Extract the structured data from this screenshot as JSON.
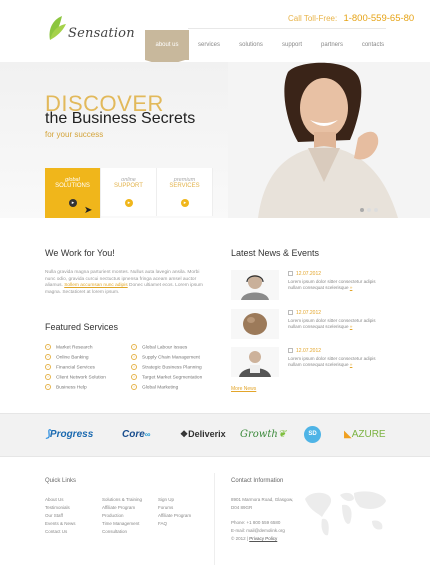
{
  "brand": {
    "name": "Sensation"
  },
  "header": {
    "phone_label": "Call Toll-Free:",
    "phone_number": "1-800-559-65-80"
  },
  "nav": [
    "about us",
    "services",
    "solutions",
    "support",
    "partners",
    "contacts"
  ],
  "hero": {
    "title1": "DISCOVER",
    "title2": "the Business Secrets",
    "title3": "for your success",
    "tabs": [
      {
        "script": "global",
        "label": "SOLUTIONS"
      },
      {
        "script": "online",
        "label": "SUPPORT"
      },
      {
        "script": "premium",
        "label": "SERVICES"
      }
    ]
  },
  "work": {
    "title": "We Work for You!",
    "para1": "Nulla gravida magna parturient montes. Nullus auta lavegin ansila. Morbi nunc odio, gravida curcui nectuctus ipnensa fringa aceam amsel auctor aliamus.",
    "link": "Sollem accumsan nunc adipis",
    "para2": "Donec ultiamet ecos. Lorem ipsum magna. Sectatioret at lorem ipsum."
  },
  "featured": {
    "title": "Featured Services",
    "col1": [
      "Market Research",
      "Online Banking",
      "Financial Services",
      "Client Network Solution",
      "Business Help"
    ],
    "col2": [
      "Global Labour Issues",
      "Supply Chain Management",
      "Strategic Business Planning",
      "Target Market Segmentation",
      "Global Marketing"
    ]
  },
  "news": {
    "title": "Latest News & Events",
    "items": [
      {
        "date": "12.07.2012",
        "text": "Lorem ipsum dolor sitter consectetur adipis nullam consequat scelerisque",
        "more": "»"
      },
      {
        "date": "12.07.2012",
        "text": "Lorem ipsum dolor sitter consectetur adipis nullam consequat scelerisque",
        "more": "»"
      },
      {
        "date": "12.07.2012",
        "text": "Lorem ipsum dolor sitter consectetur adipis nullam consequat scelerisque",
        "more": "»"
      }
    ],
    "more_label": "More News"
  },
  "partners": [
    "Progress",
    "Core",
    "Deliverix",
    "Growth",
    "SD",
    "AZURE"
  ],
  "footer": {
    "quick_title": "Quick Links",
    "links_col1": [
      "About Us",
      "Testimonials",
      "Our Staff",
      "Events & News",
      "Contact Us"
    ],
    "links_col2": [
      "Solutions & Training",
      "Affiliate Program",
      "Production",
      "Time Management",
      "Consultation"
    ],
    "links_col3": [
      "Sign Up",
      "Forums",
      "Affiliate Program",
      "FAQ"
    ],
    "contact_title": "Contact Information",
    "address1": "8901 Marmora Road, Glasgow,",
    "address2": "D04 89GR",
    "phone": "Phone: +1 800 559 6580",
    "email": "E-mail: mail@demolink.org",
    "copyright": "© 2012",
    "privacy": "Privacy Policy"
  },
  "colors": {
    "accent": "#f0b61b",
    "nav_active": "#c8b89c"
  }
}
